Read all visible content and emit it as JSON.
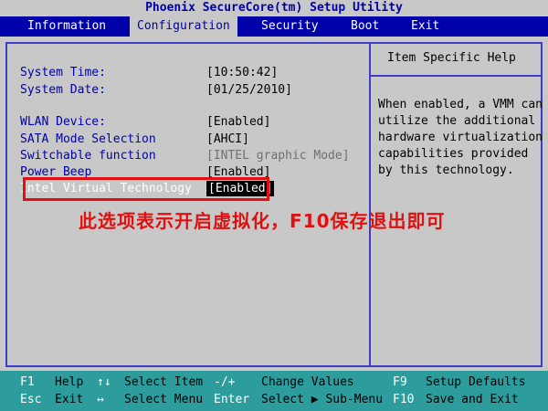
{
  "title": "Phoenix SecureCore(tm) Setup Utility",
  "menu": [
    "Information",
    "Configuration",
    "Security",
    "Boot",
    "Exit"
  ],
  "settings": [
    {
      "label": "System Time:",
      "value": "[10:50:42]"
    },
    {
      "label": "System Date:",
      "value": "[01/25/2010]"
    },
    {
      "label": "WLAN Device:",
      "value": "[Enabled]"
    },
    {
      "label": "SATA Mode Selection",
      "value": "[AHCI]"
    },
    {
      "label": "Switchable function",
      "value": "[INTEL graphic Mode]"
    },
    {
      "label": "Power Beep",
      "value": "[Enabled]"
    },
    {
      "label": "Intel Virtual Technology",
      "value": "[Enabled]"
    }
  ],
  "help": {
    "title": "Item Specific Help",
    "text": "When enabled, a VMM can\nutilize the additional\nhardware virtualization\ncapabilities provided\nby this technology."
  },
  "annotation": "此选项表示开启虚拟化，F10保存退出即可",
  "footer": {
    "row1": {
      "k1": "F1",
      "d1": "Help",
      "k2": "↑↓",
      "d2": "Select Item",
      "k3": "-/+",
      "d3": "Change Values",
      "k4": "F9",
      "d4": "Setup Defaults"
    },
    "row2": {
      "k1": "Esc",
      "d1": "Exit",
      "k2": "↔",
      "d2": "Select Menu",
      "k3": "Enter",
      "d3": "Select ▶ Sub-Menu",
      "k4": "F10",
      "d4": "Save and Exit"
    }
  }
}
